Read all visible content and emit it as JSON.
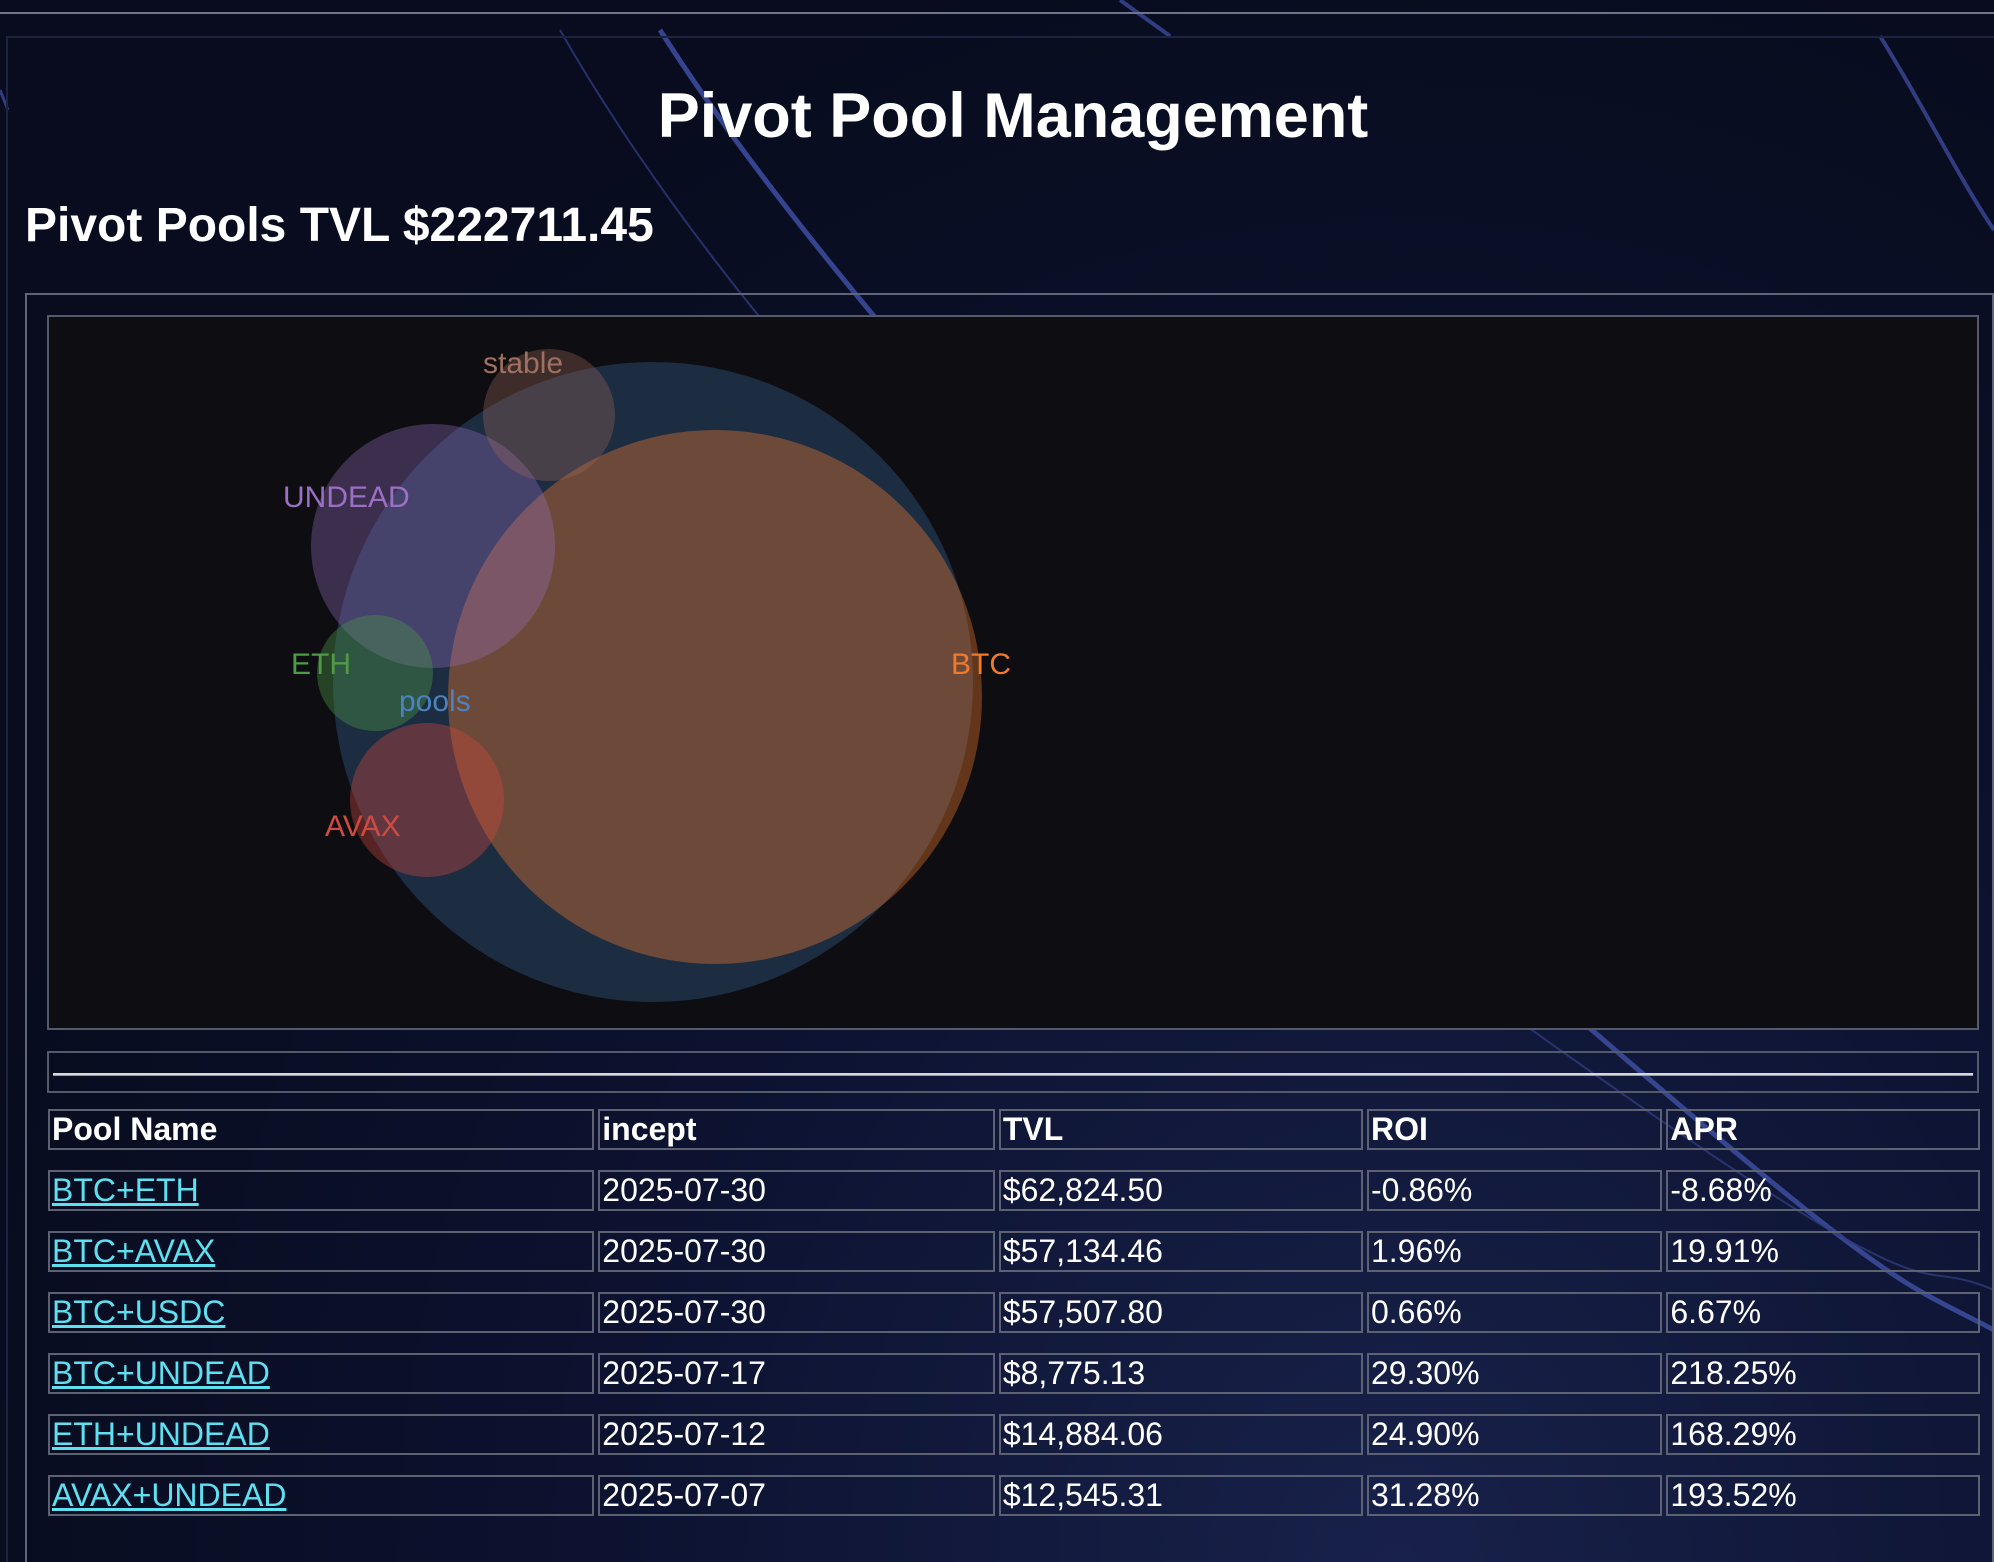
{
  "header": {
    "title": "Pivot Pool Management",
    "tvl_label": "Pivot Pools TVL $222711.45"
  },
  "chart_data": {
    "type": "bubble",
    "labels": [
      "stable",
      "UNDEAD",
      "ETH",
      "pools",
      "AVAX",
      "BTC"
    ],
    "bubbles": [
      {
        "name": "pools",
        "color": "#4a83c0"
      },
      {
        "name": "BTC",
        "color": "#f07a2a"
      },
      {
        "name": "UNDEAD",
        "color": "#9a6fc4"
      },
      {
        "name": "stable",
        "color": "#a06a5a"
      },
      {
        "name": "ETH",
        "color": "#4f9a46"
      },
      {
        "name": "AVAX",
        "color": "#d04a40"
      }
    ]
  },
  "table": {
    "headers": [
      "Pool Name",
      "incept",
      "TVL",
      "ROI",
      "APR"
    ],
    "rows": [
      {
        "name": "BTC+ETH",
        "incept": "2025-07-30",
        "tvl": "$62,824.50",
        "roi": "-0.86%",
        "apr": "-8.68%"
      },
      {
        "name": "BTC+AVAX",
        "incept": "2025-07-30",
        "tvl": "$57,134.46",
        "roi": "1.96%",
        "apr": "19.91%"
      },
      {
        "name": "BTC+USDC",
        "incept": "2025-07-30",
        "tvl": "$57,507.80",
        "roi": "0.66%",
        "apr": "6.67%"
      },
      {
        "name": "BTC+UNDEAD",
        "incept": "2025-07-17",
        "tvl": "$8,775.13",
        "roi": "29.30%",
        "apr": "218.25%"
      },
      {
        "name": "ETH+UNDEAD",
        "incept": "2025-07-12",
        "tvl": "$14,884.06",
        "roi": "24.90%",
        "apr": "168.29%"
      },
      {
        "name": "AVAX+UNDEAD",
        "incept": "2025-07-07",
        "tvl": "$12,545.31",
        "roi": "31.28%",
        "apr": "193.52%"
      }
    ]
  }
}
